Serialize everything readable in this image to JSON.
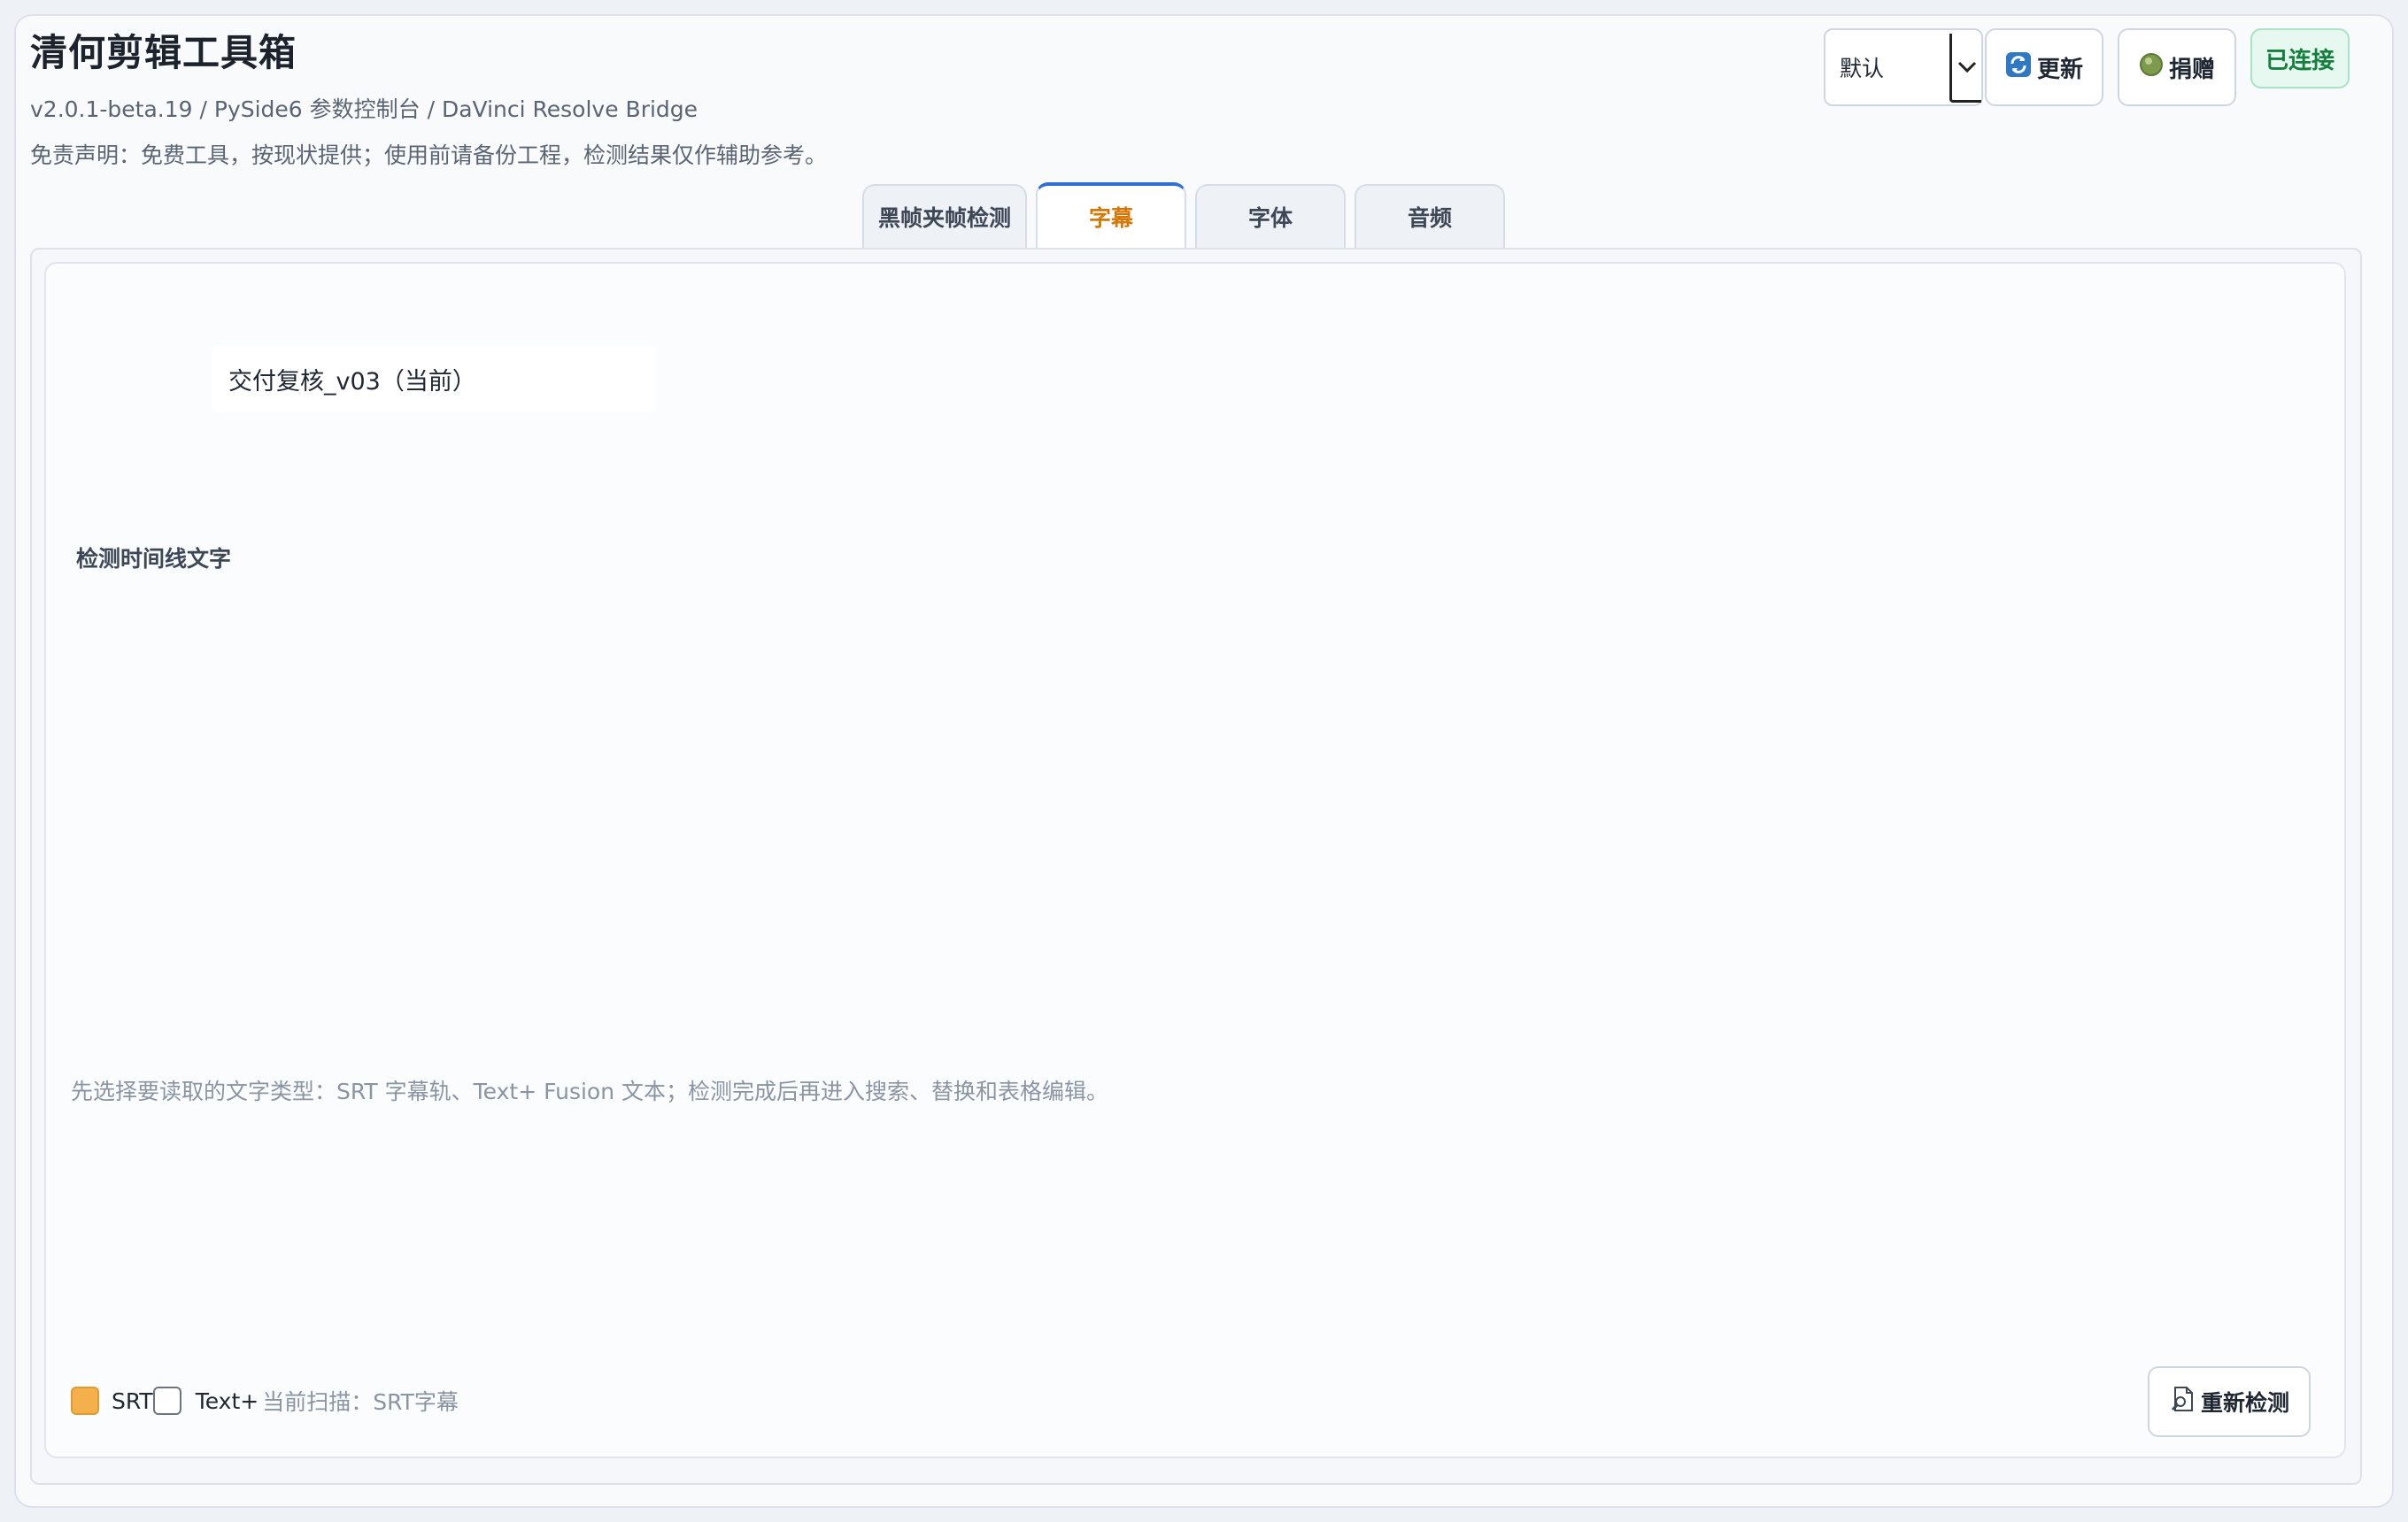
{
  "header": {
    "app_title": "清何剪辑工具箱",
    "subtitle": "v2.0.1-beta.19 / PySide6 参数控制台 / DaVinci Resolve Bridge",
    "disclaimer": "免责声明：免费工具，按现状提供；使用前请备份工程，检测结果仅作辅助参考。"
  },
  "controls": {
    "profile_select_value": "默认",
    "update_label": "更新",
    "donate_label": "捐赠",
    "connection_status": "已连接",
    "status_color": "#15803d"
  },
  "tabs": [
    {
      "label": "黑帧夹帧检测",
      "active": false
    },
    {
      "label": "字幕",
      "active": true
    },
    {
      "label": "字体",
      "active": false
    },
    {
      "label": "音频",
      "active": false
    }
  ],
  "subtitle_panel": {
    "timeline_name": "交付复核_v03（当前）",
    "section_title": "检测时间线文字",
    "hint": "先选择要读取的文字类型：SRT 字幕轨、Text+ Fusion 文本；检测完成后再进入搜索、替换和表格编辑。",
    "options": [
      {
        "label": "SRT",
        "checked": true
      },
      {
        "label": "Text+",
        "checked": false
      }
    ],
    "scan_status": "当前扫描：SRT字幕",
    "rescan_label": "重新检测"
  },
  "accent_colors": {
    "active_tab_text": "#d97706",
    "active_tab_border": "#2f6fd6",
    "checkbox_checked": "#f4b04a"
  },
  "icons": [
    "refresh-icon",
    "donate-coin-icon",
    "chevron-down-icon",
    "document-search-icon"
  ]
}
